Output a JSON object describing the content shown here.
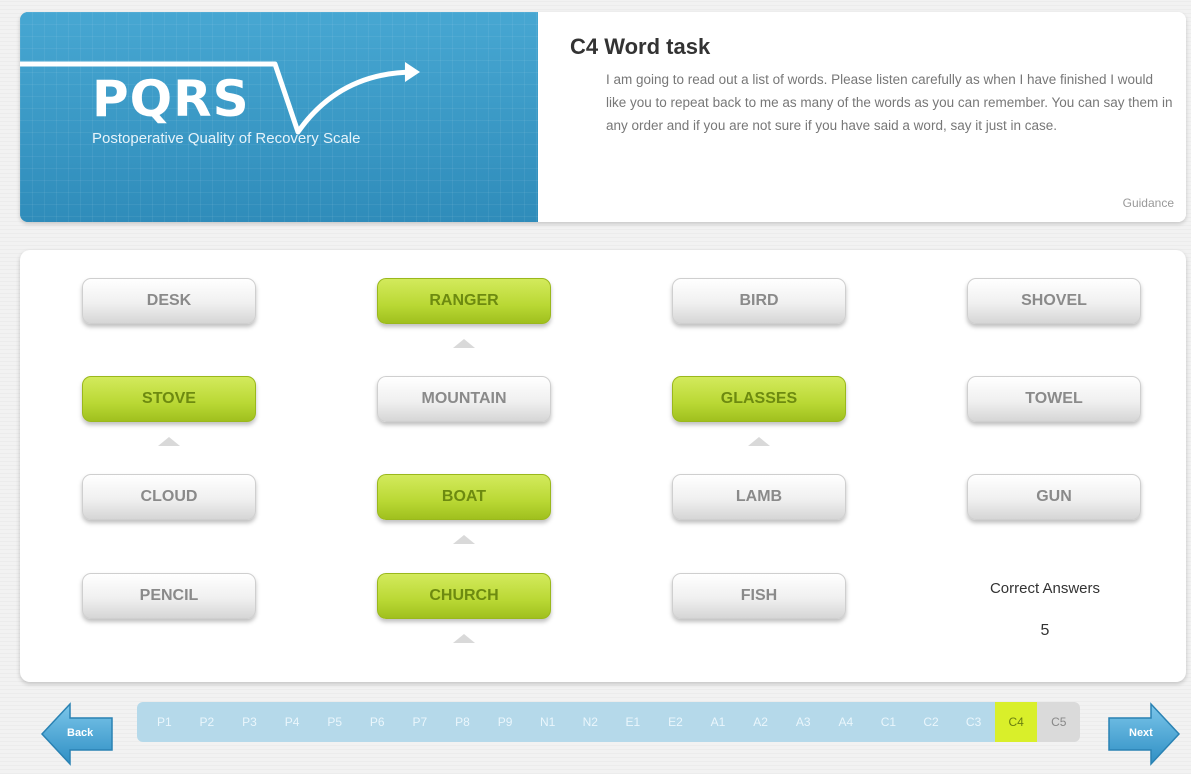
{
  "header": {
    "logo_text": "PQRS",
    "logo_subtitle": "Postoperative Quality of Recovery Scale",
    "task_title": "C4 Word task",
    "instructions": "I am going to read out a list of words. Please listen carefully as when I have finished I would like you to repeat back to me as many of the words as you can remember. You can say them in any order and if you are not sure if you have said a word, say it just in case.",
    "guidance_label": "Guidance"
  },
  "words": [
    {
      "label": "DESK",
      "selected": false
    },
    {
      "label": "RANGER",
      "selected": true
    },
    {
      "label": "BIRD",
      "selected": false
    },
    {
      "label": "SHOVEL",
      "selected": false
    },
    {
      "label": "STOVE",
      "selected": true
    },
    {
      "label": "MOUNTAIN",
      "selected": false
    },
    {
      "label": "GLASSES",
      "selected": true
    },
    {
      "label": "TOWEL",
      "selected": false
    },
    {
      "label": "CLOUD",
      "selected": false
    },
    {
      "label": "BOAT",
      "selected": true
    },
    {
      "label": "LAMB",
      "selected": false
    },
    {
      "label": "GUN",
      "selected": false
    },
    {
      "label": "PENCIL",
      "selected": false
    },
    {
      "label": "CHURCH",
      "selected": true
    },
    {
      "label": "FISH",
      "selected": false
    }
  ],
  "correct_answers": {
    "label": "Correct Answers",
    "count": "5"
  },
  "nav": {
    "back_label": "Back",
    "next_label": "Next",
    "pages": [
      "P1",
      "P2",
      "P3",
      "P4",
      "P5",
      "P6",
      "P7",
      "P8",
      "P9",
      "N1",
      "N2",
      "E1",
      "E2",
      "A1",
      "A2",
      "A3",
      "A4",
      "C1",
      "C2",
      "C3",
      "C4",
      "C5"
    ],
    "active_page": "C4"
  }
}
